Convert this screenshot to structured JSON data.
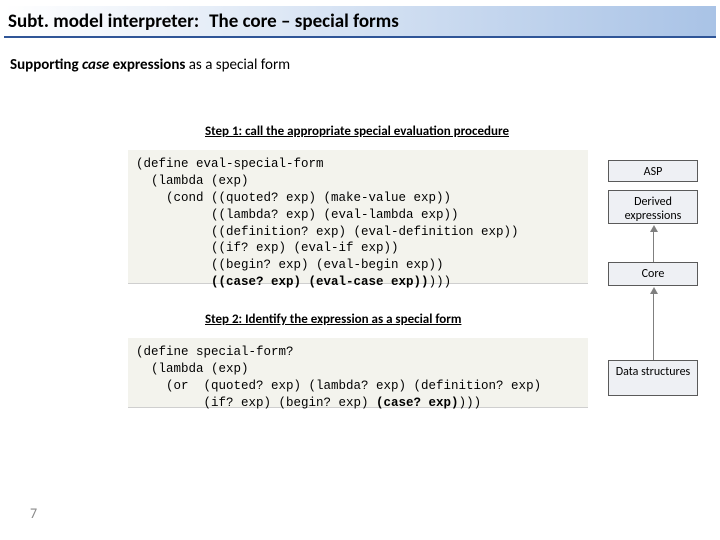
{
  "title": {
    "prefix": "Subt. model interpreter:",
    "main": "The core – special forms"
  },
  "subtitle": {
    "lead": "Supporting ",
    "em": "case",
    "mid": " expressions",
    "tail": "  as a special form"
  },
  "steps": {
    "s1": "Step 1: call the appropriate special evaluation procedure",
    "s2": "Step 2: Identify the expression as a special form"
  },
  "code1": {
    "l1": "(define eval-special-form",
    "l2": "  (lambda (exp)",
    "l3": "    (cond ((quoted? exp) (make-value exp))",
    "l4": "          ((lambda? exp) (eval-lambda exp))",
    "l5": "          ((definition? exp) (eval-definition exp))",
    "l6": "          ((if? exp) (eval-if exp))",
    "l7": "          ((begin? exp) (eval-begin exp))",
    "l8a": "          ",
    "l8b": "((case? exp) (eval-case exp))",
    "l8c": ")))"
  },
  "code2": {
    "l1": "(define special-form?",
    "l2": "  (lambda (exp)",
    "l3": "    (or  (quoted? exp) (lambda? exp) (definition? exp)",
    "l4a": "         (if? exp) (begin? exp) ",
    "l4b": "(case? exp)",
    "l4c": ")))"
  },
  "sidebar": {
    "asp": "ASP",
    "derived": "Derived expressions",
    "core": "Core",
    "data": "Data structures"
  },
  "pagenum": "7"
}
